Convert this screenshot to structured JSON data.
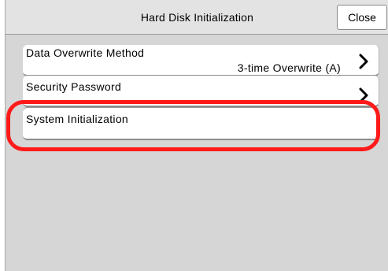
{
  "header": {
    "title": "Hard Disk Initialization",
    "close_label": "Close"
  },
  "items": [
    {
      "label": "Data Overwrite Method",
      "value": "3-time Overwrite (A)",
      "icon": "chevron-right-icon"
    },
    {
      "label": "Security Password",
      "icon": "chevron-right-icon"
    },
    {
      "label": "System Initialization"
    }
  ],
  "annotation": {
    "highlight_color": "#ff1a1a",
    "highlighted_item": "System Initialization"
  }
}
